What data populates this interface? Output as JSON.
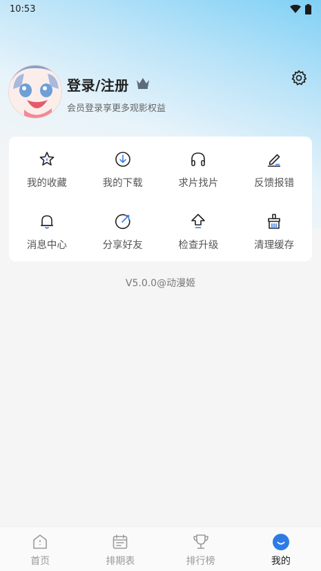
{
  "status_bar": {
    "time": "10:53"
  },
  "profile": {
    "title": "登录/注册",
    "subtitle": "会员登录享更多观影权益"
  },
  "menu": [
    {
      "label": "我的收藏",
      "icon": "star-icon"
    },
    {
      "label": "我的下载",
      "icon": "download-icon"
    },
    {
      "label": "求片找片",
      "icon": "headphones-icon"
    },
    {
      "label": "反馈报错",
      "icon": "pen-icon"
    },
    {
      "label": "消息中心",
      "icon": "bell-icon"
    },
    {
      "label": "分享好友",
      "icon": "share-icon"
    },
    {
      "label": "检查升级",
      "icon": "upgrade-arrow-icon"
    },
    {
      "label": "清理缓存",
      "icon": "broom-icon"
    }
  ],
  "version": "V5.0.0@动漫姬",
  "bottom_nav": [
    {
      "label": "首页",
      "icon": "home-icon",
      "active": false
    },
    {
      "label": "排期表",
      "icon": "calendar-icon",
      "active": false
    },
    {
      "label": "排行榜",
      "icon": "trophy-icon",
      "active": false
    },
    {
      "label": "我的",
      "icon": "profile-smile-icon",
      "active": true
    }
  ],
  "colors": {
    "accent": "#3b7be8",
    "nav_active": "#222222",
    "nav_inactive": "#9a9a9a"
  }
}
